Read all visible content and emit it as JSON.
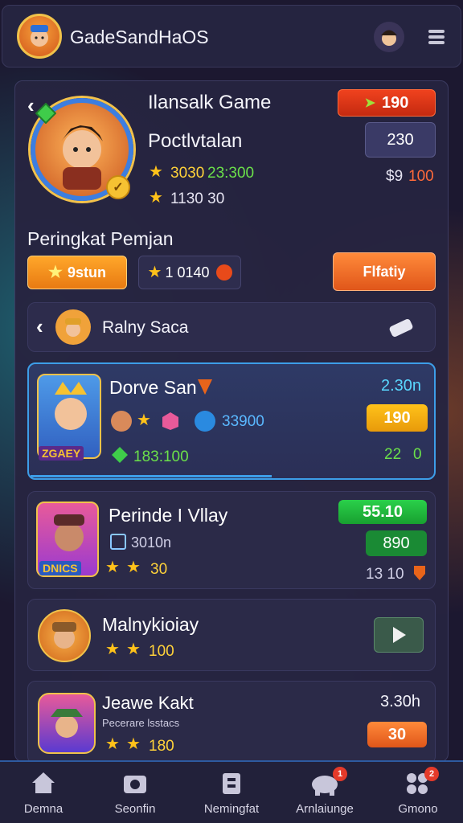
{
  "header": {
    "title": "GadeSandHaOS"
  },
  "profile": {
    "game_title": "Ilansalk Game",
    "player_name": "Poctlvtalan",
    "stat1": "3030",
    "stat1b": "23:300",
    "stat2": "1130 30",
    "badge_top": "190",
    "badge_mid": "230",
    "currency_a": "$9",
    "currency_b": "100"
  },
  "ranking": {
    "title": "Peringkat Pemjan",
    "tab_active": "9stun",
    "tab_value": "1 0140",
    "action_button": "Flfatiy"
  },
  "search_row": {
    "label": "Ralny Saca"
  },
  "players": [
    {
      "name": "Dorve San",
      "score": "2.30n",
      "stat_a": "33900",
      "stat_b": "183:100",
      "badge": "190",
      "extra_a": "22",
      "extra_b": "0",
      "tag": "ZGAEY"
    },
    {
      "name": "Perinde I Vllay",
      "score": "55.10",
      "stat_a": "3010n",
      "stat_b": "30",
      "badge": "890",
      "extra_a": "13 10",
      "tag": "DNICS"
    },
    {
      "name": "Malnykioiay",
      "stat_b": "100"
    },
    {
      "name": "Jeawe Kakt",
      "subtitle": "Pecerare lsstacs",
      "score": "3.30h",
      "stat_b": "180",
      "badge": "30"
    }
  ],
  "nav": [
    {
      "label": "Demna",
      "icon": "home-icon"
    },
    {
      "label": "Seonfin",
      "icon": "camera-icon"
    },
    {
      "label": "Nemingfat",
      "icon": "clipboard-icon",
      "badge": ""
    },
    {
      "label": "Arnlaiunge",
      "icon": "elephant-icon",
      "badge": "1"
    },
    {
      "label": "Gmono",
      "icon": "group-icon",
      "badge": "2"
    }
  ],
  "colors": {
    "accent_orange": "#f07a1e",
    "accent_red": "#e8341c",
    "accent_green": "#1fb33a",
    "accent_yellow": "#f4b400"
  }
}
